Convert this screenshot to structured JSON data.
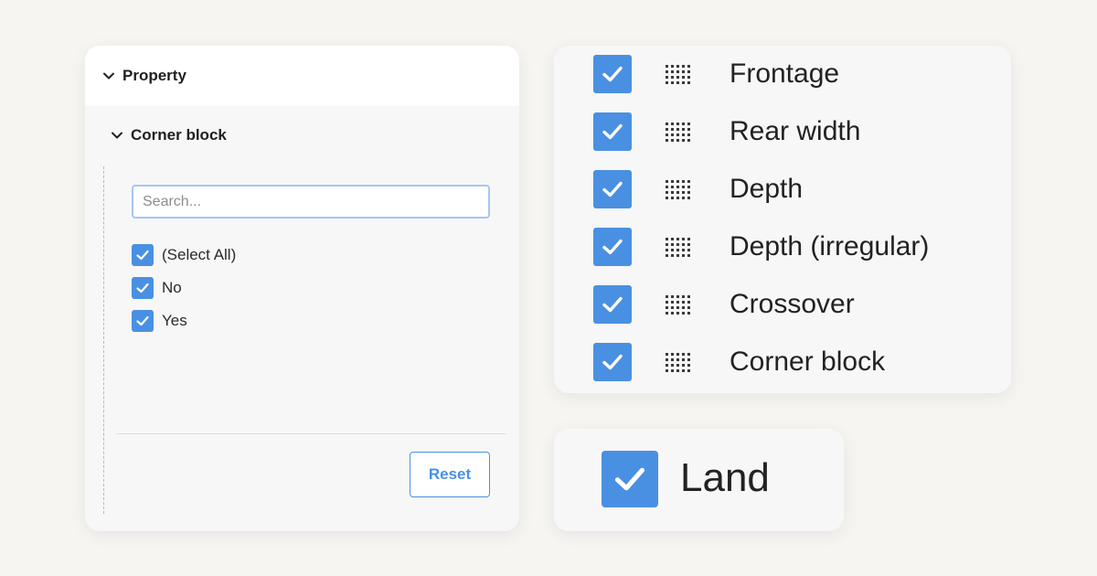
{
  "colors": {
    "background": "#f6f5f1",
    "accent": "#4a90e2",
    "panel": "#f7f7f7"
  },
  "filter_panel": {
    "header": {
      "icon": "chevron-down-icon",
      "label": "Property"
    },
    "section": {
      "icon": "chevron-down-icon",
      "label": "Corner block"
    },
    "search": {
      "placeholder": "Search...",
      "value": ""
    },
    "options": [
      {
        "label": "(Select All)",
        "checked": true
      },
      {
        "label": "No",
        "checked": true
      },
      {
        "label": "Yes",
        "checked": true
      }
    ],
    "reset_label": "Reset"
  },
  "column_list": {
    "drag_icon": "drag-handle-icon",
    "items": [
      {
        "label": "Frontage",
        "checked": true
      },
      {
        "label": "Rear width",
        "checked": true
      },
      {
        "label": "Depth",
        "checked": true
      },
      {
        "label": "Depth (irregular)",
        "checked": true
      },
      {
        "label": "Crossover",
        "checked": true
      },
      {
        "label": "Corner block",
        "checked": true
      }
    ]
  },
  "land_card": {
    "label": "Land",
    "checked": true
  }
}
